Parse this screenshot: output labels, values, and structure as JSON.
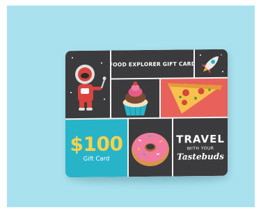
{
  "card": {
    "title": "FOOD EXPLORER GIFT CARD",
    "amount": "$100",
    "amount_label": "Gift Card",
    "travel_big": "TRAVEL",
    "travel_small": "WITH YOUR",
    "travel_script": "Tastebuds"
  },
  "colors": {
    "background": "#a9e2ee",
    "tile_dark": "#3b3b3d",
    "teal": "#27b4c9",
    "pizza_red": "#e9615b",
    "amount_yellow": "#f6d24d"
  },
  "icons": [
    "astronaut-illustration",
    "rocket-icon",
    "cupcake-illustration",
    "pizza-slice-illustration",
    "donut-illustration"
  ]
}
